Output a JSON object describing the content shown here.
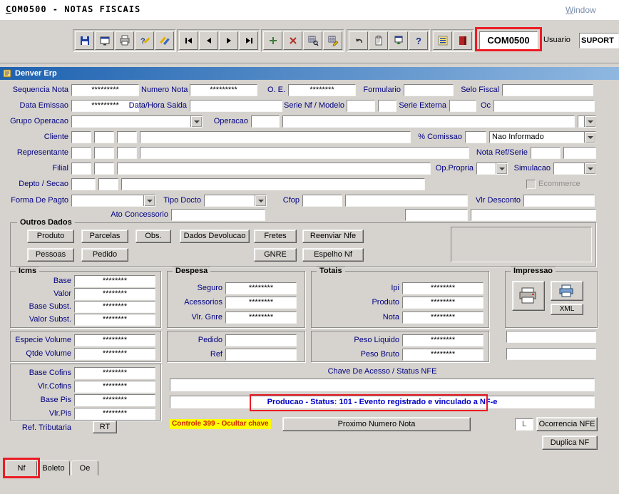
{
  "header": {
    "title": "COM0500 - NOTAS FISCAIS",
    "window_menu": "Window"
  },
  "toolbar": {
    "form_code": "COM0500",
    "user_label": "Usuario",
    "user_value": "SUPORT",
    "groups": [
      [
        "save",
        "print-preview",
        "print",
        "help-edit",
        "edit-wizard"
      ],
      [
        "nav-first",
        "nav-prev",
        "nav-next",
        "nav-last"
      ],
      [
        "add-record",
        "delete-record",
        "query-enter",
        "query-execute"
      ],
      [
        "undo",
        "paste",
        "open-form",
        "help"
      ],
      [
        "menu",
        "exit"
      ]
    ]
  },
  "titlebar": {
    "app_name": "Denver Erp"
  },
  "form": {
    "sequencia_nota": {
      "label": "Sequencia Nota",
      "value": "*********"
    },
    "numero_nota": {
      "label": "Numero Nota",
      "value": "*********"
    },
    "oe": {
      "label": "O. E.",
      "value": "********"
    },
    "formulario": {
      "label": "Formulario"
    },
    "selo_fiscal": {
      "label": "Selo Fiscal"
    },
    "data_emissao": {
      "label": "Data Emissao",
      "value": "*********"
    },
    "data_hora_saida": {
      "label": "Data/Hora Saida"
    },
    "serie_nf_modelo": {
      "label": "Serie Nf / Modelo"
    },
    "serie_externa": {
      "label": "Serie Externa"
    },
    "oc": {
      "label": "Oc"
    },
    "grupo_operacao": {
      "label": "Grupo Operacao"
    },
    "operacao": {
      "label": "Operacao"
    },
    "cliente": {
      "label": "Cliente"
    },
    "comissao": {
      "label": "% Comissao"
    },
    "comissao_tipo": {
      "value": "Nao Informado"
    },
    "representante": {
      "label": "Representante"
    },
    "nota_ref_serie": {
      "label": "Nota Ref/Serie"
    },
    "filial": {
      "label": "Filial"
    },
    "op_propria": {
      "label": "Op.Propria"
    },
    "simulacao": {
      "label": "Simulacao"
    },
    "depto_secao": {
      "label": "Depto / Secao"
    },
    "ecommerce": {
      "label": "Ecommerce"
    },
    "forma_pagto": {
      "label": "Forma De Pagto"
    },
    "tipo_docto": {
      "label": "Tipo Docto"
    },
    "cfop": {
      "label": "Cfop"
    },
    "vlr_desconto": {
      "label": "Vlr Desconto"
    },
    "ato_concessorio": {
      "label": "Ato Concessorio"
    }
  },
  "outros_dados": {
    "title": "Outros Dados",
    "buttons_row1": [
      "Produto",
      "Parcelas",
      "Obs.",
      "Dados Devolucao",
      "Fretes",
      "Reenviar Nfe"
    ],
    "buttons_row2": [
      "Pessoas",
      "Pedido",
      "GNRE",
      "Espelho Nf"
    ]
  },
  "icms": {
    "title": "Icms",
    "group1": [
      {
        "label": "Base",
        "value": "********"
      },
      {
        "label": "Valor",
        "value": "********"
      },
      {
        "label": "Base Subst.",
        "value": "********"
      },
      {
        "label": "Valor Subst.",
        "value": "********"
      }
    ],
    "group2": [
      {
        "label": "Especie Volume",
        "value": "********"
      },
      {
        "label": "Qtde Volume",
        "value": "********"
      }
    ],
    "group3": [
      {
        "label": "Base Cofins",
        "value": "********"
      },
      {
        "label": "Vlr.Cofins",
        "value": "********"
      },
      {
        "label": "Base Pis",
        "value": "********"
      },
      {
        "label": "Vlr.Pis",
        "value": "********"
      }
    ],
    "ref_tributaria_label": "Ref. Tributaria",
    "ref_tributaria_button": "RT"
  },
  "despesa": {
    "title": "Despesa",
    "rows": [
      {
        "label": "Seguro",
        "value": "********"
      },
      {
        "label": "Acessorios",
        "value": "********"
      },
      {
        "label": "Vlr. Gnre",
        "value": "********"
      }
    ],
    "extra": [
      {
        "label": "Pedido"
      },
      {
        "label": "Ref"
      }
    ]
  },
  "totais": {
    "title": "Totais",
    "rows": [
      {
        "label": "Ipi",
        "value": "********"
      },
      {
        "label": "Produto",
        "value": "********"
      },
      {
        "label": "Nota",
        "value": "********"
      }
    ],
    "extra": [
      {
        "label": "Peso Liquido",
        "value": "********"
      },
      {
        "label": "Peso Bruto",
        "value": "********"
      }
    ]
  },
  "impressao": {
    "title": "Impressao",
    "xml_label": "XML"
  },
  "nfe": {
    "chave_title": "Chave De Acesso / Status NFE",
    "status_text": "Producao - Status: 101 - Evento registrado e vinculado a NF-e",
    "controle_note": "Controle 399 - Ocultar chave",
    "proximo_numero_button": "Proximo Numero Nota",
    "l_indicator": "L",
    "ocorrencia_button": "Ocorrencia NFE",
    "duplica_button": "Duplica NF"
  },
  "tabs": [
    {
      "label": "Nf",
      "active": true
    },
    {
      "label": "Boleto",
      "active": false
    },
    {
      "label": "Oe",
      "active": false
    }
  ],
  "colors": {
    "annotation_red": "#ec1c24",
    "status_blue": "#0000c8",
    "label_navy": "#000080",
    "note_yellow": "#ffff00",
    "note_red": "#cc2200"
  }
}
